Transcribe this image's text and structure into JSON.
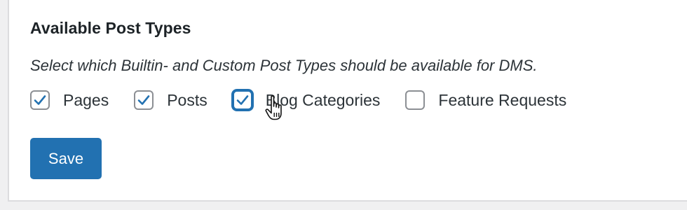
{
  "settings": {
    "section_title": "Available Post Types",
    "description": "Select which Builtin- and Custom Post Types should be available for DMS.",
    "post_types": [
      {
        "label": "Pages",
        "checked": true
      },
      {
        "label": "Posts",
        "checked": true
      },
      {
        "label": "Blog Categories",
        "checked": true,
        "focused": true
      },
      {
        "label": "Feature Requests",
        "checked": false
      }
    ],
    "save_label": "Save"
  },
  "colors": {
    "accent": "#2271b1",
    "checkbox_border": "#8c8f94",
    "text": "#2c3338",
    "background": "#f0f0f1"
  },
  "icons": {
    "check": "check-icon",
    "cursor": "hand-pointer-cursor-icon"
  }
}
